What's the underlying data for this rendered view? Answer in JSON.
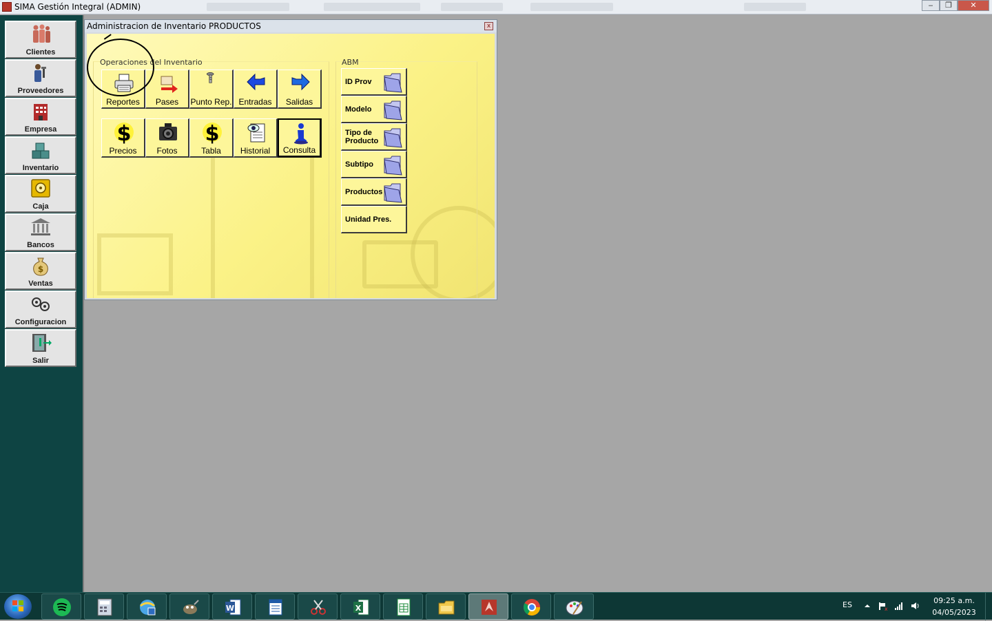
{
  "window": {
    "title": "SIMA Gestión Integral (ADMIN)",
    "minimize": "‒",
    "maximize": "❐",
    "close": "✕"
  },
  "sidebar": {
    "items": [
      {
        "label": "Clientes",
        "icon": "people-icon"
      },
      {
        "label": "Proveedores",
        "icon": "suppliers-icon"
      },
      {
        "label": "Empresa",
        "icon": "building-icon"
      },
      {
        "label": "Inventario",
        "icon": "boxes-icon"
      },
      {
        "label": "Caja",
        "icon": "safe-icon"
      },
      {
        "label": "Bancos",
        "icon": "bank-icon"
      },
      {
        "label": "Ventas",
        "icon": "money-bag-icon"
      },
      {
        "label": "Configuracion",
        "icon": "settings-icon"
      },
      {
        "label": "Salir",
        "icon": "exit-door-icon"
      }
    ]
  },
  "inventory_window": {
    "title": "Administracion de Inventario PRODUCTOS",
    "close": "x",
    "operations_group": {
      "label": "Operaciones del Inventario",
      "row1": [
        "Reportes",
        "Pases",
        "Punto Rep.",
        "Entradas",
        "Salidas"
      ],
      "row2": [
        "Precios",
        "Fotos",
        "Tabla",
        "Historial",
        "Consulta"
      ]
    },
    "abm_group": {
      "label": "ABM",
      "items": [
        "ID Prov",
        "Modelo",
        "Tipo de Producto",
        "Subtipo",
        "Productos",
        "Unidad Pres."
      ]
    }
  },
  "taskbar": {
    "apps": [
      "Spotify",
      "Calculator",
      "Internet Explorer",
      "Gimp",
      "Word",
      "Notepad",
      "Snipping Tool",
      "Excel",
      "Spreadsheet",
      "File Explorer",
      "SIMA",
      "Chrome",
      "Paint"
    ],
    "active_app": "SIMA",
    "language": "ES",
    "time": "09:25 a.m.",
    "date": "04/05/2023"
  },
  "colors": {
    "sidebar_bg": "#0e4443",
    "mdi_bg": "#a6a6a6",
    "panel_yellow": "#fbf287",
    "taskbar_bg": "#0d3735"
  }
}
